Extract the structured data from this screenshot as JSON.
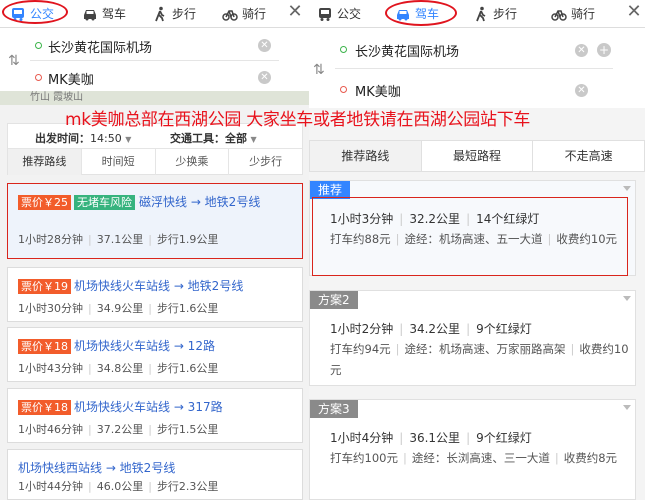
{
  "left": {
    "modes": [
      {
        "label": "公交",
        "icon": "bus-icon"
      },
      {
        "label": "驾车",
        "icon": "car-icon"
      },
      {
        "label": "步行",
        "icon": "walk-icon"
      },
      {
        "label": "骑行",
        "icon": "bike-icon"
      }
    ],
    "from": "长沙黄花国际机场",
    "to": "MK美咖",
    "map_label": "竹山  霞坡山",
    "depart_label": "出发时间：",
    "depart_value": "14:50",
    "tool_label": "交通工具：",
    "tool_value": "全部",
    "filter_tabs": [
      "推荐路线",
      "时间短",
      "少换乘",
      "少步行"
    ],
    "routes": [
      {
        "price": "票价￥25",
        "risk": "无堵车风险",
        "name": "磁浮快线 → 地铁2号线",
        "time": "1小时28分钟",
        "dist": "37.1公里",
        "walk": "步行1.9公里"
      },
      {
        "price": "票价￥19",
        "risk": "",
        "name": "机场快线火车站线 → 地铁2号线",
        "time": "1小时30分钟",
        "dist": "34.9公里",
        "walk": "步行1.6公里"
      },
      {
        "price": "票价￥18",
        "risk": "",
        "name": "机场快线火车站线 → 12路",
        "time": "1小时43分钟",
        "dist": "34.8公里",
        "walk": "步行1.6公里"
      },
      {
        "price": "票价￥18",
        "risk": "",
        "name": "机场快线火车站线 → 317路",
        "time": "1小时46分钟",
        "dist": "37.2公里",
        "walk": "步行1.5公里"
      },
      {
        "price": "",
        "risk": "",
        "name": "机场快线西站线 → 地铁2号线",
        "time": "1小时44分钟",
        "dist": "46.0公里",
        "walk": "步行2.3公里"
      }
    ]
  },
  "right": {
    "modes": [
      {
        "label": "公交",
        "icon": "bus-icon"
      },
      {
        "label": "驾车",
        "icon": "car-icon"
      },
      {
        "label": "步行",
        "icon": "walk-icon"
      },
      {
        "label": "骑行",
        "icon": "bike-icon"
      }
    ],
    "from": "长沙黄花国际机场",
    "to": "MK美咖",
    "tabs": [
      "推荐路线",
      "最短路程",
      "不走高速"
    ],
    "plans": [
      {
        "tag": "推荐",
        "time": "1小时3分钟",
        "dist": "32.2公里",
        "lights": "14个红绿灯",
        "taxi": "打车约88元",
        "via": "途经：机场高速、五一大道",
        "toll": "收费约10元"
      },
      {
        "tag": "方案2",
        "time": "1小时2分钟",
        "dist": "34.2公里",
        "lights": "9个红绿灯",
        "taxi": "打车约94元",
        "via": "途经：机场高速、万家丽路高架",
        "toll": "收费约10元"
      },
      {
        "tag": "方案3",
        "time": "1小时4分钟",
        "dist": "36.1公里",
        "lights": "9个红绿灯",
        "taxi": "打车约100元",
        "via": "途经：长浏高速、三一大道",
        "toll": "收费约8元"
      }
    ]
  },
  "annotation": "mk美咖总部在西湖公园 大家坐车或者地铁请在西湖公园站下车",
  "colors": {
    "accent": "#3385ff",
    "highlight": "#e0141e",
    "price": "#f25c2b",
    "risk": "#36b37e"
  }
}
